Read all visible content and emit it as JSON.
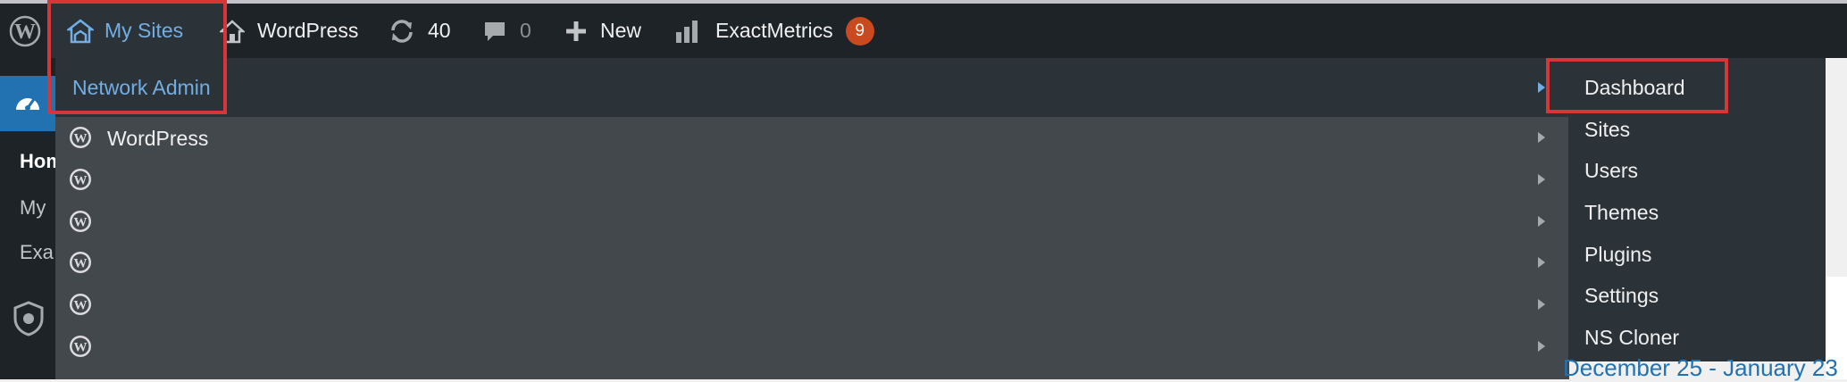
{
  "admin_bar": {
    "my_sites_label": "My Sites",
    "site_name": "WordPress",
    "updates_count": "40",
    "comments_count": "0",
    "new_label": "New",
    "plugin_label": "ExactMetrics",
    "plugin_badge": "9"
  },
  "dropdown": {
    "network_admin_label": "Network Admin",
    "sites": [
      {
        "label": "WordPress"
      },
      {
        "label": ""
      },
      {
        "label": ""
      },
      {
        "label": ""
      },
      {
        "label": ""
      },
      {
        "label": ""
      }
    ]
  },
  "network_submenu": {
    "items": [
      "Dashboard",
      "Sites",
      "Users",
      "Themes",
      "Plugins",
      "Settings",
      "NS Cloner"
    ]
  },
  "left_menu": {
    "home_label": "Hom",
    "my_label": "My",
    "exa_label": "Exa"
  },
  "content": {
    "date_range_text": "December 25 - January 23"
  },
  "colors": {
    "admin_bar_bg": "#1d2327",
    "dropdown_bg": "#2c3338",
    "sites_list_bg": "#43484d",
    "link_blue": "#72aee6",
    "badge_orange": "#ca4a1f",
    "highlight_red": "#d63638"
  }
}
